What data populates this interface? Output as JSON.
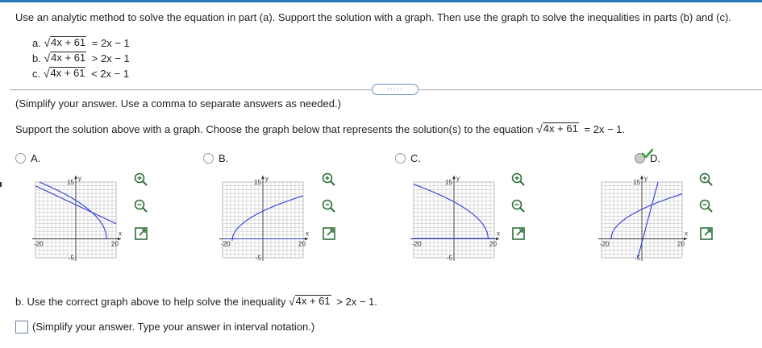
{
  "header": {
    "instructions": "Use an analytic method to solve the equation in part (a). Support the solution with a graph. Then use the graph to solve the inequalities in parts (b) and (c)."
  },
  "parts": [
    {
      "label": "a.",
      "radicand": "4x + 61",
      "relation": "= 2x − 1"
    },
    {
      "label": "b.",
      "radicand": "4x + 61",
      "relation": "> 2x − 1"
    },
    {
      "label": "c.",
      "radicand": "4x + 61",
      "relation": "< 2x − 1"
    }
  ],
  "more_button": "·····",
  "simplify_note_a": "(Simplify your answer. Use a comma to separate answers as needed.)",
  "support_question": {
    "prefix": "Support the solution above with a graph. Choose the graph below that represents the solution(s) to the equation",
    "radicand": "4x + 61",
    "suffix": "= 2x − 1."
  },
  "graph_labels": {
    "x": "x",
    "y": "y",
    "xmin": "-20",
    "xmax": "20",
    "ymax": "15",
    "ymin": "-5"
  },
  "options": [
    {
      "label": "A.",
      "selected": false
    },
    {
      "label": "B.",
      "selected": false
    },
    {
      "label": "C.",
      "selected": false
    },
    {
      "label": "D.",
      "selected": true
    }
  ],
  "part_b": {
    "prefix": "b. Use the correct graph above to help solve the inequality",
    "radicand": "4x + 61",
    "suffix": "> 2x − 1."
  },
  "simplify_note_b": "(Simplify your answer. Type your answer in interval notation.)",
  "colors": {
    "accent": "#2b78b5",
    "curve": "#2f3fd6",
    "check": "#3aa03a",
    "zoom": "#2f6f3a"
  }
}
